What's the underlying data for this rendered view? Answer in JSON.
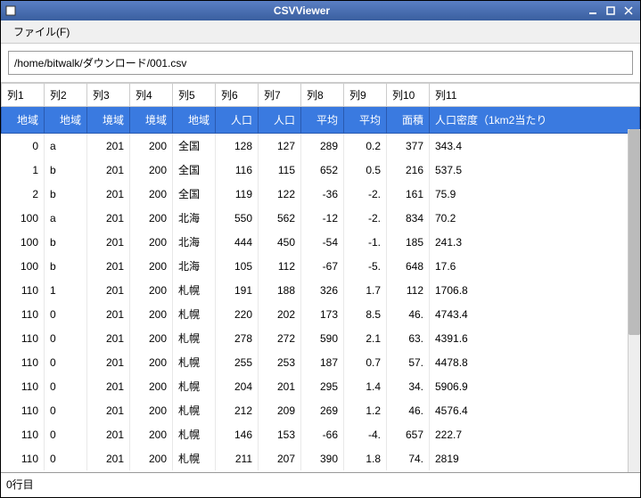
{
  "titlebar": {
    "title": "CSVViewer"
  },
  "menubar": {
    "file": "ファイル(F)"
  },
  "toolbar": {
    "path": "/home/bitwalk/ダウンロード/001.csv"
  },
  "statusbar": {
    "text": "0行目"
  },
  "table": {
    "colheaders": [
      "列1",
      "列2",
      "列3",
      "列4",
      "列5",
      "列6",
      "列7",
      "列8",
      "列9",
      "列10",
      "列11"
    ],
    "subheaders": [
      "地域",
      "地域",
      "境域",
      "境域",
      "地域",
      "人口",
      "人口",
      "平均",
      "平均",
      "面積",
      "人口密度（1km2当たり"
    ],
    "rows": [
      [
        "0",
        "a",
        "201",
        "200",
        "全国",
        "128",
        "127",
        "289",
        "0.2",
        "377",
        "343.4"
      ],
      [
        "1",
        "b",
        "201",
        "200",
        "全国",
        "116",
        "115",
        "652",
        "0.5",
        "216",
        "537.5"
      ],
      [
        "2",
        "b",
        "201",
        "200",
        "全国",
        "119",
        "122",
        "-36",
        "-2.",
        "161",
        "75.9"
      ],
      [
        "100",
        "a",
        "201",
        "200",
        "北海",
        "550",
        "562",
        "-12",
        "-2.",
        "834",
        "70.2"
      ],
      [
        "100",
        "b",
        "201",
        "200",
        "北海",
        "444",
        "450",
        "-54",
        "-1.",
        "185",
        "241.3"
      ],
      [
        "100",
        "b",
        "201",
        "200",
        "北海",
        "105",
        "112",
        "-67",
        "-5.",
        "648",
        "17.6"
      ],
      [
        "110",
        "1",
        "201",
        "200",
        "札幌",
        "191",
        "188",
        "326",
        "1.7",
        "112",
        "1706.8"
      ],
      [
        "110",
        "0",
        "201",
        "200",
        "札幌",
        "220",
        "202",
        "173",
        "8.5",
        "46.",
        "4743.4"
      ],
      [
        "110",
        "0",
        "201",
        "200",
        "札幌",
        "278",
        "272",
        "590",
        "2.1",
        "63.",
        "4391.6"
      ],
      [
        "110",
        "0",
        "201",
        "200",
        "札幌",
        "255",
        "253",
        "187",
        "0.7",
        "57.",
        "4478.8"
      ],
      [
        "110",
        "0",
        "201",
        "200",
        "札幌",
        "204",
        "201",
        "295",
        "1.4",
        "34.",
        "5906.9"
      ],
      [
        "110",
        "0",
        "201",
        "200",
        "札幌",
        "212",
        "209",
        "269",
        "1.2",
        "46.",
        "4576.4"
      ],
      [
        "110",
        "0",
        "201",
        "200",
        "札幌",
        "146",
        "153",
        "-66",
        "-4.",
        "657",
        "222.7"
      ],
      [
        "110",
        "0",
        "201",
        "200",
        "札幌",
        "211",
        "207",
        "390",
        "1.8",
        "74.",
        "2819"
      ]
    ]
  }
}
